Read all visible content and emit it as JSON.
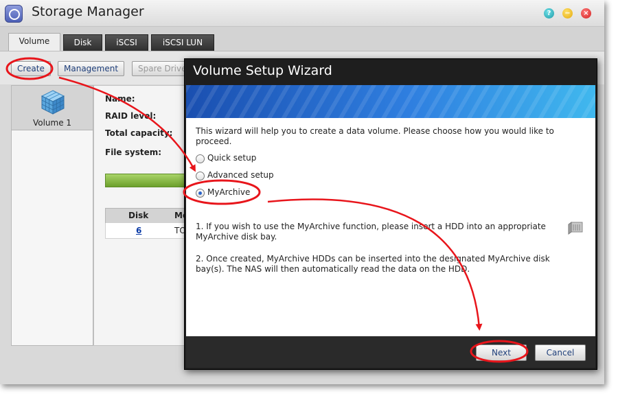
{
  "window": {
    "title": "Storage Manager"
  },
  "titlebar_buttons": {
    "help": "?",
    "minimize": "−",
    "close": "×"
  },
  "tabs": [
    {
      "label": "Volume",
      "active": true
    },
    {
      "label": "Disk",
      "active": false
    },
    {
      "label": "iSCSI",
      "active": false
    },
    {
      "label": "iSCSI LUN",
      "active": false
    }
  ],
  "toolbar": {
    "create_label": "Create",
    "management_label": "Management",
    "spare_label": "Spare Drive"
  },
  "sidebar": {
    "items": [
      {
        "label": "Volume 1",
        "icon": "cube-icon"
      }
    ]
  },
  "details": {
    "name_label": "Name:",
    "raid_label": "RAID level:",
    "capacity_label": "Total capacity:",
    "filesystem_label": "File system:",
    "table": {
      "headers": [
        "Disk",
        "Mo"
      ],
      "rows": [
        {
          "disk": "6",
          "model": "TO"
        }
      ]
    }
  },
  "dialog": {
    "title": "Volume Setup Wizard",
    "intro": "This wizard will help you to create a data volume. Please choose how you would like to proceed.",
    "options": [
      {
        "label": "Quick setup",
        "selected": false
      },
      {
        "label": "Advanced setup",
        "selected": false
      },
      {
        "label": "MyArchive",
        "selected": true
      }
    ],
    "note1": "1. If you wish to use the MyArchive function, please insert a HDD into an appropriate MyArchive disk bay.",
    "note2": "2. Once created, MyArchive HDDs can be inserted into the designated MyArchive disk bay(s). The NAS will then automatically read the data on the HDD.",
    "next_label": "Next",
    "cancel_label": "Cancel"
  },
  "colors": {
    "annotation": "#e8151b",
    "banner": "#2f7fe0",
    "progress": "#8cc043"
  }
}
